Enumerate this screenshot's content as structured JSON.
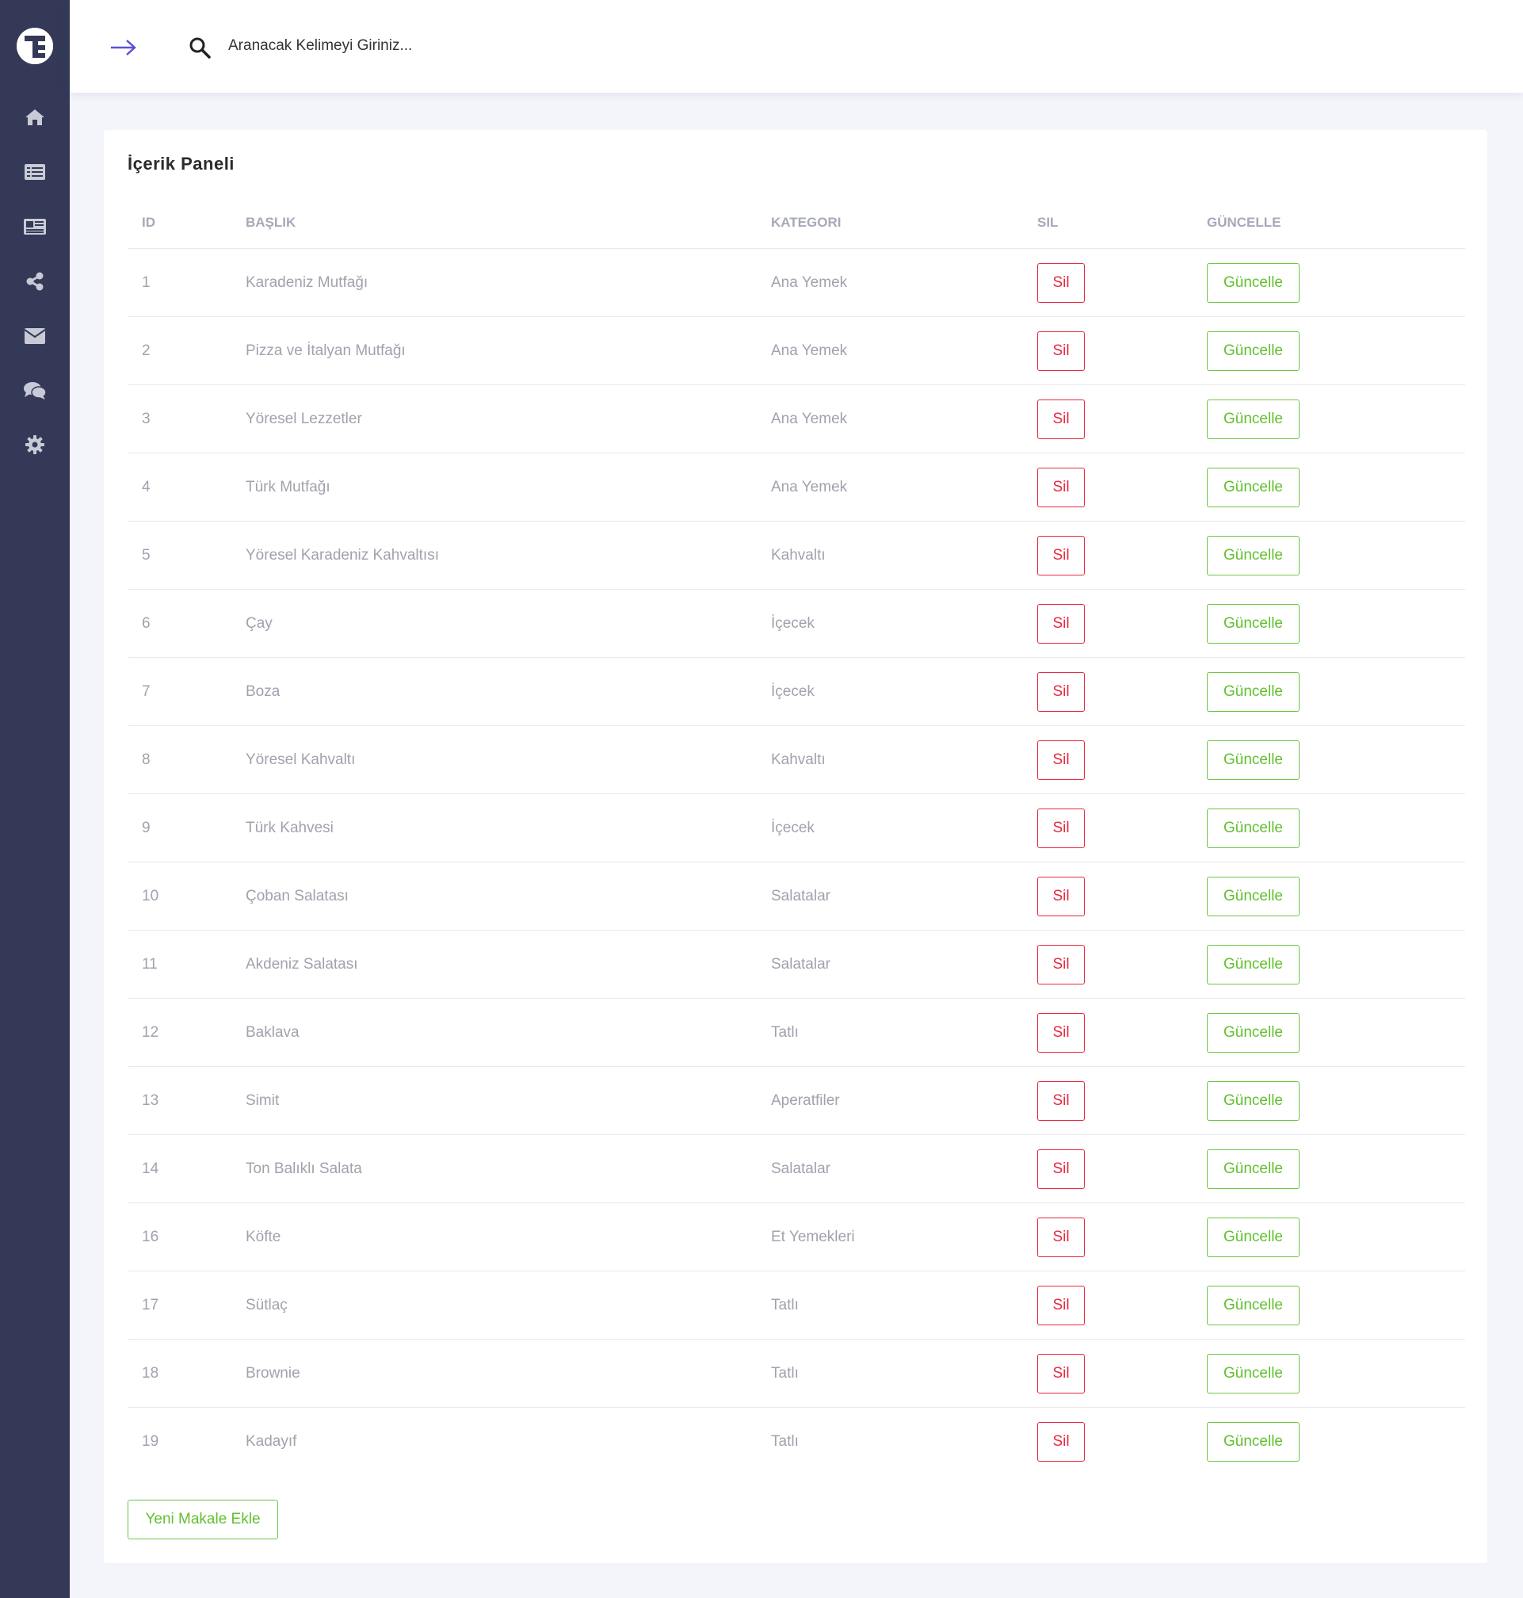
{
  "sidebar": {
    "logo_icon": "brand-logo-icon",
    "items": [
      {
        "name": "home",
        "icon": "home-icon"
      },
      {
        "name": "list",
        "icon": "list-icon"
      },
      {
        "name": "news",
        "icon": "newspaper-icon"
      },
      {
        "name": "share",
        "icon": "share-icon"
      },
      {
        "name": "mail",
        "icon": "envelope-icon"
      },
      {
        "name": "comments",
        "icon": "comments-icon"
      },
      {
        "name": "settings",
        "icon": "gear-icon"
      }
    ],
    "bg_color": "#343957"
  },
  "topbar": {
    "toggle_icon": "arrow-right-icon",
    "accent_color": "#5b4fe0",
    "search": {
      "icon": "search-icon",
      "placeholder": "Aranacak Kelimeyi Giriniz...",
      "value": ""
    }
  },
  "panel": {
    "title": "İçerik Paneli",
    "columns": {
      "id": "ID",
      "title": "BAŞLIK",
      "category": "KATEGORI",
      "delete": "SIL",
      "update": "GÜNCELLE"
    },
    "rows": [
      {
        "id": "1",
        "title": "Karadeniz Mutfağı",
        "category": "Ana Yemek",
        "delete": "Sil",
        "update": "Güncelle"
      },
      {
        "id": "2",
        "title": "Pizza ve İtalyan Mutfağı",
        "category": "Ana Yemek",
        "delete": "Sil",
        "update": "Güncelle"
      },
      {
        "id": "3",
        "title": "Yöresel Lezzetler",
        "category": "Ana Yemek",
        "delete": "Sil",
        "update": "Güncelle"
      },
      {
        "id": "4",
        "title": "Türk Mutfağı",
        "category": "Ana Yemek",
        "delete": "Sil",
        "update": "Güncelle"
      },
      {
        "id": "5",
        "title": "Yöresel Karadeniz Kahvaltısı",
        "category": "Kahvaltı",
        "delete": "Sil",
        "update": "Güncelle"
      },
      {
        "id": "6",
        "title": "Çay",
        "category": "İçecek",
        "delete": "Sil",
        "update": "Güncelle"
      },
      {
        "id": "7",
        "title": "Boza",
        "category": "İçecek",
        "delete": "Sil",
        "update": "Güncelle"
      },
      {
        "id": "8",
        "title": "Yöresel Kahvaltı",
        "category": "Kahvaltı",
        "delete": "Sil",
        "update": "Güncelle"
      },
      {
        "id": "9",
        "title": "Türk Kahvesi",
        "category": "İçecek",
        "delete": "Sil",
        "update": "Güncelle"
      },
      {
        "id": "10",
        "title": "Çoban Salatası",
        "category": "Salatalar",
        "delete": "Sil",
        "update": "Güncelle"
      },
      {
        "id": "11",
        "title": "Akdeniz Salatası",
        "category": "Salatalar",
        "delete": "Sil",
        "update": "Güncelle"
      },
      {
        "id": "12",
        "title": "Baklava",
        "category": "Tatlı",
        "delete": "Sil",
        "update": "Güncelle"
      },
      {
        "id": "13",
        "title": "Simit",
        "category": "Aperatfiler",
        "delete": "Sil",
        "update": "Güncelle"
      },
      {
        "id": "14",
        "title": "Ton Balıklı Salata",
        "category": "Salatalar",
        "delete": "Sil",
        "update": "Güncelle"
      },
      {
        "id": "16",
        "title": "Köfte",
        "category": "Et Yemekleri",
        "delete": "Sil",
        "update": "Güncelle"
      },
      {
        "id": "17",
        "title": "Sütlaç",
        "category": "Tatlı",
        "delete": "Sil",
        "update": "Güncelle"
      },
      {
        "id": "18",
        "title": "Brownie",
        "category": "Tatlı",
        "delete": "Sil",
        "update": "Güncelle"
      },
      {
        "id": "19",
        "title": "Kadayıf",
        "category": "Tatlı",
        "delete": "Sil",
        "update": "Güncelle"
      }
    ],
    "add_button": "Yeni Makale Ekle",
    "colors": {
      "delete": "#e8283e",
      "update": "#62c02f"
    }
  }
}
